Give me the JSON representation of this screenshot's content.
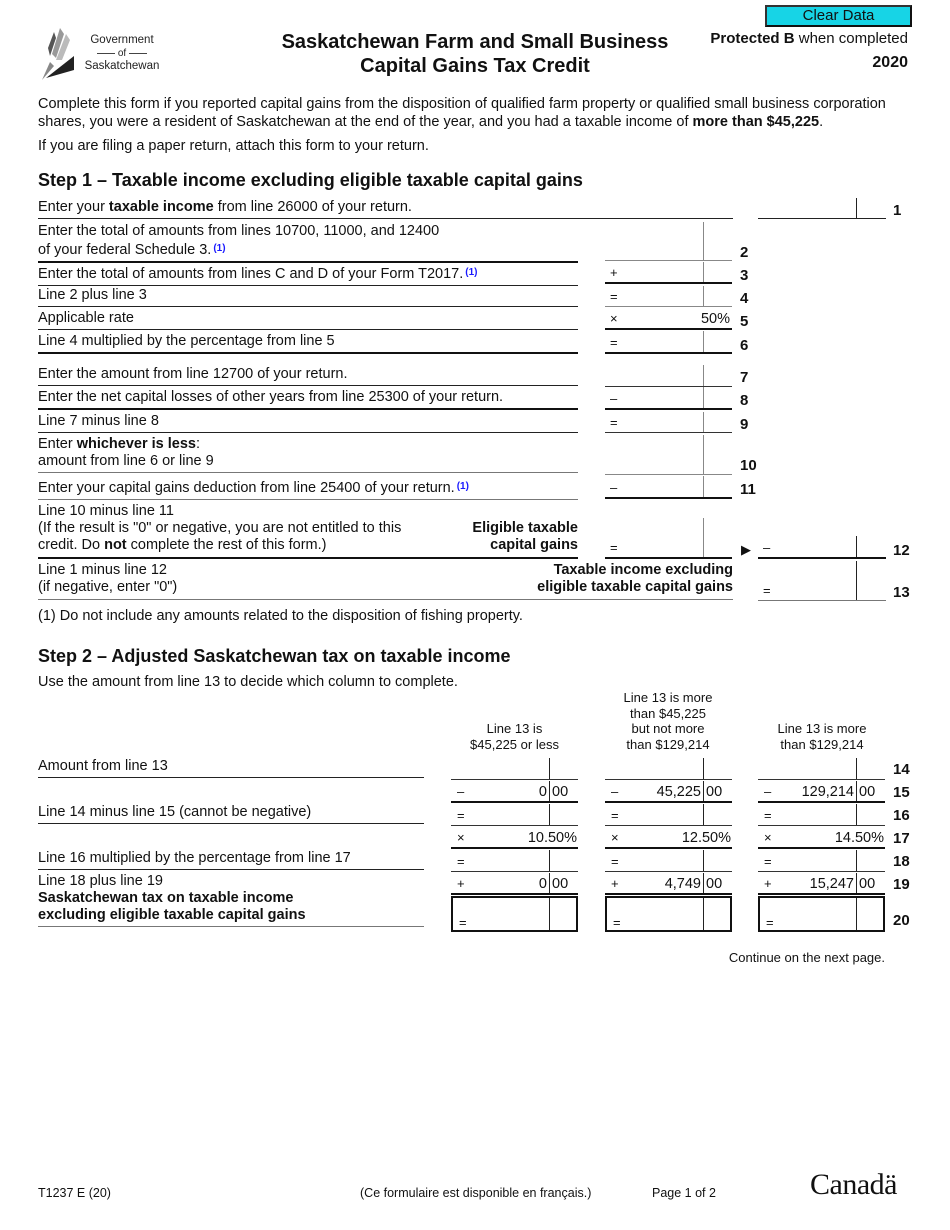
{
  "header": {
    "logo_line1": "Government",
    "logo_line2": "of",
    "logo_line3": "Saskatchewan",
    "title_line1": "Saskatchewan Farm and Small Business",
    "title_line2": "Capital Gains Tax Credit",
    "clear_button": "Clear Data",
    "protected_bold": "Protected B",
    "protected_rest": " when completed",
    "year": "2020"
  },
  "intro": {
    "para1_a": "Complete this form if you reported capital gains from the disposition of qualified farm property or qualified small business corporation shares, you were a resident of Saskatchewan at the end of the year, and you had a taxable income of ",
    "para1_bold": "more than $45,225",
    "para1_end": ".",
    "para2": "If you are filing a paper return, attach this form to your return."
  },
  "step1": {
    "heading": "Step 1 – Taxable income excluding eligible taxable capital gains",
    "footnote_marker": "(1)",
    "lines": [
      {
        "num": "1",
        "pre": "Enter your ",
        "bold": "taxable income",
        "post": " from line 26000 of your return."
      },
      {
        "num": "2",
        "text1": "Enter the total of amounts from lines 10700, 11000, and 12400",
        "text2": "of your federal Schedule 3.",
        "op": ""
      },
      {
        "num": "3",
        "text": "Enter the total of amounts from lines C and D of your Form T2017.",
        "op": "+"
      },
      {
        "num": "4",
        "text": "Line 2 plus line 3",
        "op": "="
      },
      {
        "num": "5",
        "text": "Applicable rate",
        "op": "×",
        "value": "50%"
      },
      {
        "num": "6",
        "text": "Line 4 multiplied by the percentage from line 5",
        "op": "="
      },
      {
        "num": "7",
        "text": "Enter the amount from line 12700 of your return.",
        "op": ""
      },
      {
        "num": "8",
        "text": "Enter the net capital losses of other years from line 25300 of your return.",
        "op": "–"
      },
      {
        "num": "9",
        "text": "Line 7 minus line 8",
        "op": "="
      },
      {
        "num": "10",
        "pre": "Enter ",
        "bold": "whichever is less",
        "post": ":",
        "text2": "amount from line 6 or line 9",
        "op": ""
      },
      {
        "num": "11",
        "text": "Enter your capital gains deduction from line 25400 of your return.",
        "op": "–"
      },
      {
        "num": "12",
        "text1": "Line 10 minus line 11",
        "text2": "(If the result is \"0\" or negative, you are not entitled to this",
        "text3_pre": "credit. Do ",
        "text3_bold": "not",
        "text3_post": " complete the rest of this form.)",
        "side_label1": "Eligible taxable",
        "side_label2": "capital gains",
        "op": "=",
        "op2": "–",
        "arrow": "▶"
      },
      {
        "num": "13",
        "text1": "Line 1 minus line 12",
        "text2": "(if negative, enter \"0\")",
        "side_label1": "Taxable income excluding",
        "side_label2": "eligible taxable capital gains",
        "op": "="
      }
    ],
    "footnote": "(1) Do not include any amounts related to the disposition of fishing property."
  },
  "step2": {
    "heading": "Step 2 – Adjusted Saskatchewan tax on taxable income",
    "instruction": "Use the amount from line 13 to decide which column to complete.",
    "columns": [
      {
        "header": [
          "Line 13 is",
          "$45,225 or less"
        ]
      },
      {
        "header": [
          "Line 13 is more",
          "than $45,225",
          "but not more",
          "than $129,214"
        ]
      },
      {
        "header": [
          "Line 13 is more",
          "than $129,214"
        ]
      }
    ],
    "rows": [
      {
        "num": "14",
        "label": "Amount from line 13",
        "ops": [
          "",
          "",
          ""
        ]
      },
      {
        "num": "15",
        "label": "",
        "ops": [
          "–",
          "–",
          "–"
        ],
        "dollars": [
          "0",
          "45,225",
          "129,214"
        ],
        "cents": [
          "00",
          "00",
          "00"
        ]
      },
      {
        "num": "16",
        "label": "Line 14 minus line 15 (cannot be negative)",
        "ops": [
          "=",
          "=",
          "="
        ]
      },
      {
        "num": "17",
        "label": "",
        "ops": [
          "×",
          "×",
          "×"
        ],
        "rates": [
          "10.50%",
          "12.50%",
          "14.50%"
        ]
      },
      {
        "num": "18",
        "label": "Line 16 multiplied by the percentage from line 17",
        "ops": [
          "=",
          "=",
          "="
        ]
      },
      {
        "num": "19",
        "label": "Line 18 plus line 19",
        "ops": [
          "+",
          "+",
          "+"
        ],
        "dollars": [
          "0",
          "4,749",
          "15,247"
        ],
        "cents": [
          "00",
          "00",
          "00"
        ]
      },
      {
        "num": "20",
        "label1": "Saskatchewan tax on taxable income",
        "label2": "excluding eligible taxable capital gains",
        "ops": [
          "=",
          "=",
          "="
        ]
      }
    ],
    "continue": "Continue on the next page."
  },
  "footer": {
    "form_id": "T1237 E (20)",
    "french": "(Ce formulaire est disponible en français.)",
    "page": "Page 1 of 2",
    "wordmark": "Canadä"
  }
}
